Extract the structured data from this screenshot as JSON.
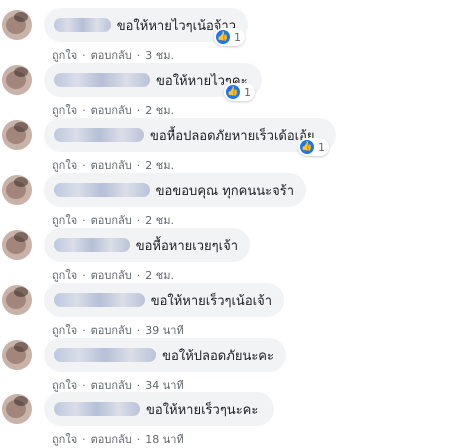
{
  "comments": [
    {
      "text": "ขอให้หายไวๆเน้อจ้าว",
      "like": "ถูกใจ",
      "reply": "ตอบกลับ",
      "time": "3 ชม.",
      "reaction_count": "1"
    },
    {
      "text": "ขอให้หายไวๆคะ",
      "like": "ถูกใจ",
      "reply": "ตอบกลับ",
      "time": "2 ชม.",
      "reaction_count": "1"
    },
    {
      "text": "ขอหื้อปลอดภัยหายเร็วเด้อเอ้ย",
      "like": "ถูกใจ",
      "reply": "ตอบกลับ",
      "time": "2 ชม.",
      "reaction_count": "1"
    },
    {
      "text": "ขอขอบคุณ ทุกคนนะจร้า",
      "like": "ถูกใจ",
      "reply": "ตอบกลับ",
      "time": "2 ชม.",
      "reaction_count": ""
    },
    {
      "text": "ขอหื้อหายเวยๆเจ้า",
      "like": "ถูกใจ",
      "reply": "ตอบกลับ",
      "time": "2 ชม.",
      "reaction_count": ""
    },
    {
      "text": "ขอให้หายเร็วๆเน้อเจ้า",
      "like": "ถูกใจ",
      "reply": "ตอบกลับ",
      "time": "39 นาที",
      "reaction_count": ""
    },
    {
      "text": "ขอให้ปลอดภัยนะคะ",
      "like": "ถูกใจ",
      "reply": "ตอบกลับ",
      "time": "34 นาที",
      "reaction_count": ""
    },
    {
      "text": "ขอให้หายเร็วๆนะคะ",
      "like": "ถูกใจ",
      "reply": "ตอบกลับ",
      "time": "18 นาที",
      "reaction_count": ""
    }
  ],
  "colors": {
    "bubble": "#f2f3f5",
    "like_blue": "#1877f2",
    "meta": "#606770"
  },
  "icons": {
    "reaction": "like-thumb-icon"
  }
}
